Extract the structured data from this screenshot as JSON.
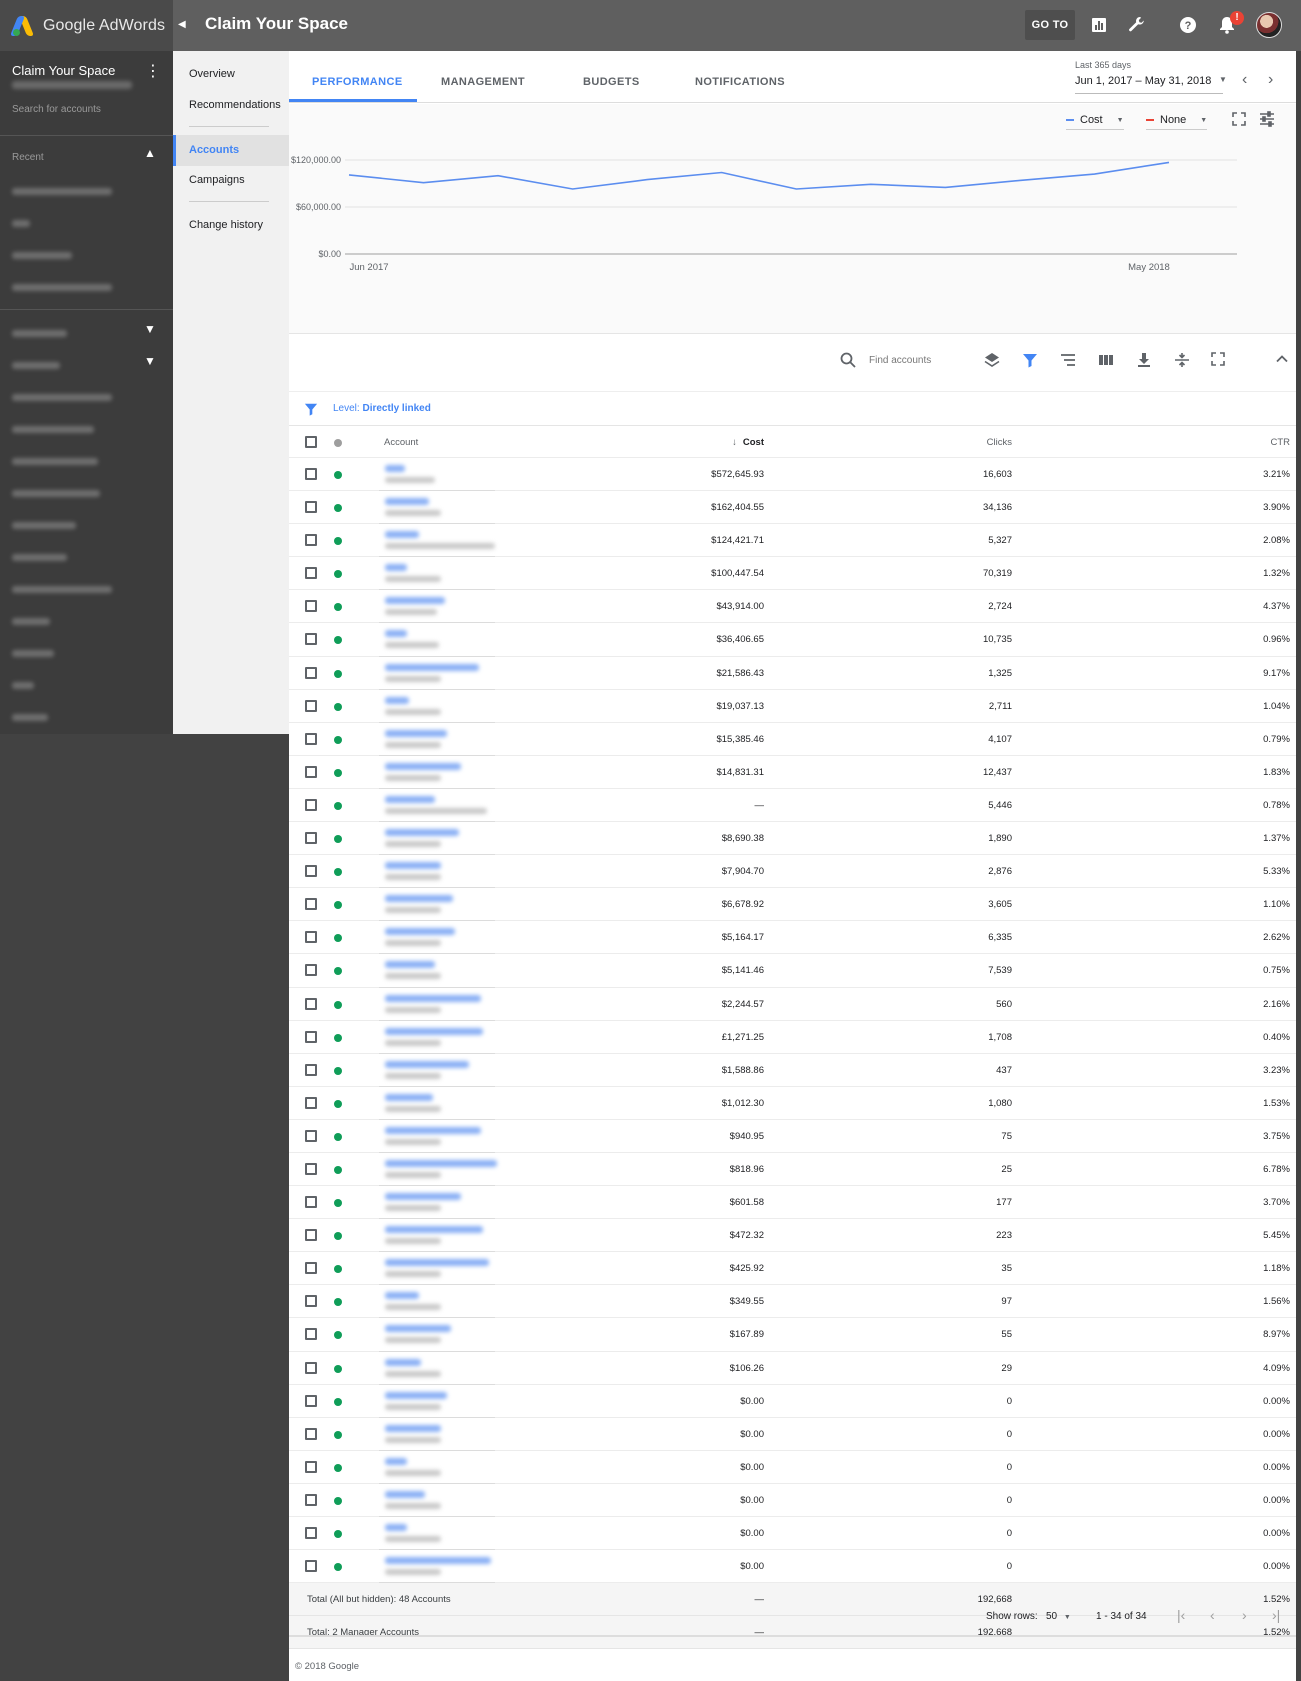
{
  "header": {
    "brand": "Google AdWords",
    "title": "Claim Your Space",
    "goto_label": "GO TO",
    "notification_badge": "!"
  },
  "leftnav": {
    "account_name": "Claim Your Space",
    "search_placeholder": "Search for accounts",
    "recent_label": "Recent"
  },
  "subnav": {
    "items": [
      "Overview",
      "Recommendations",
      "Accounts",
      "Campaigns",
      "Change history"
    ],
    "active": "Accounts"
  },
  "tabs": [
    "PERFORMANCE",
    "MANAGEMENT",
    "BUDGETS",
    "NOTIFICATIONS"
  ],
  "active_tab": "PERFORMANCE",
  "date": {
    "label": "Last 365 days",
    "range": "Jun 1, 2017 – May 31, 2018"
  },
  "chart": {
    "metric1": "Cost",
    "metric2": "None",
    "metric1_color": "#5b8def",
    "metric2_color": "#ea4335"
  },
  "chart_data": {
    "type": "line",
    "series": [
      {
        "name": "Cost",
        "values": [
          101000,
          91000,
          100000,
          83000,
          95000,
          104000,
          83000,
          89000,
          85000,
          94000,
          102000,
          117000
        ]
      }
    ],
    "y_ticks": [
      "$0.00",
      "$60,000.00",
      "$120,000.00"
    ],
    "ylim": [
      0,
      120000
    ],
    "x_tick_labels": [
      "Jun 2017",
      "May 2018"
    ]
  },
  "table_toolbar": {
    "search_placeholder": "Find accounts"
  },
  "filter": {
    "label": "Level: ",
    "value": "Directly linked"
  },
  "table": {
    "columns": {
      "account": "Account",
      "cost": "Cost",
      "clicks": "Clicks",
      "ctr": "CTR"
    },
    "rows": [
      {
        "cost": "$572,645.93",
        "clicks": "16,603",
        "ctr": "3.21%"
      },
      {
        "cost": "$162,404.55",
        "clicks": "34,136",
        "ctr": "3.90%"
      },
      {
        "cost": "$124,421.71",
        "clicks": "5,327",
        "ctr": "2.08%"
      },
      {
        "cost": "$100,447.54",
        "clicks": "70,319",
        "ctr": "1.32%"
      },
      {
        "cost": "$43,914.00",
        "clicks": "2,724",
        "ctr": "4.37%"
      },
      {
        "cost": "$36,406.65",
        "clicks": "10,735",
        "ctr": "0.96%"
      },
      {
        "cost": "$21,586.43",
        "clicks": "1,325",
        "ctr": "9.17%"
      },
      {
        "cost": "$19,037.13",
        "clicks": "2,711",
        "ctr": "1.04%"
      },
      {
        "cost": "$15,385.46",
        "clicks": "4,107",
        "ctr": "0.79%"
      },
      {
        "cost": "$14,831.31",
        "clicks": "12,437",
        "ctr": "1.83%"
      },
      {
        "cost": "—",
        "clicks": "5,446",
        "ctr": "0.78%"
      },
      {
        "cost": "$8,690.38",
        "clicks": "1,890",
        "ctr": "1.37%"
      },
      {
        "cost": "$7,904.70",
        "clicks": "2,876",
        "ctr": "5.33%"
      },
      {
        "cost": "$6,678.92",
        "clicks": "3,605",
        "ctr": "1.10%"
      },
      {
        "cost": "$5,164.17",
        "clicks": "6,335",
        "ctr": "2.62%"
      },
      {
        "cost": "$5,141.46",
        "clicks": "7,539",
        "ctr": "0.75%"
      },
      {
        "cost": "$2,244.57",
        "clicks": "560",
        "ctr": "2.16%"
      },
      {
        "cost": "£1,271.25",
        "clicks": "1,708",
        "ctr": "0.40%"
      },
      {
        "cost": "$1,588.86",
        "clicks": "437",
        "ctr": "3.23%"
      },
      {
        "cost": "$1,012.30",
        "clicks": "1,080",
        "ctr": "1.53%"
      },
      {
        "cost": "$940.95",
        "clicks": "75",
        "ctr": "3.75%"
      },
      {
        "cost": "$818.96",
        "clicks": "25",
        "ctr": "6.78%"
      },
      {
        "cost": "$601.58",
        "clicks": "177",
        "ctr": "3.70%"
      },
      {
        "cost": "$472.32",
        "clicks": "223",
        "ctr": "5.45%"
      },
      {
        "cost": "$425.92",
        "clicks": "35",
        "ctr": "1.18%"
      },
      {
        "cost": "$349.55",
        "clicks": "97",
        "ctr": "1.56%"
      },
      {
        "cost": "$167.89",
        "clicks": "55",
        "ctr": "8.97%"
      },
      {
        "cost": "$106.26",
        "clicks": "29",
        "ctr": "4.09%"
      },
      {
        "cost": "$0.00",
        "clicks": "0",
        "ctr": "0.00%"
      },
      {
        "cost": "$0.00",
        "clicks": "0",
        "ctr": "0.00%"
      },
      {
        "cost": "$0.00",
        "clicks": "0",
        "ctr": "0.00%"
      },
      {
        "cost": "$0.00",
        "clicks": "0",
        "ctr": "0.00%"
      },
      {
        "cost": "$0.00",
        "clicks": "0",
        "ctr": "0.00%"
      },
      {
        "cost": "$0.00",
        "clicks": "0",
        "ctr": "0.00%"
      }
    ],
    "totals": [
      {
        "label": "Total (All but hidden): 48 Accounts",
        "cost": "—",
        "clicks": "192,668",
        "ctr": "1.52%"
      },
      {
        "label": "Total: 2 Manager Accounts",
        "cost": "—",
        "clicks": "192,668",
        "ctr": "1.52%"
      }
    ]
  },
  "pager": {
    "show_rows_label": "Show rows:",
    "rows_value": "50",
    "range": "1 - 34 of 34"
  },
  "footer": "© 2018 Google",
  "status_color": "#0f9d58",
  "accent": "#4285f4"
}
